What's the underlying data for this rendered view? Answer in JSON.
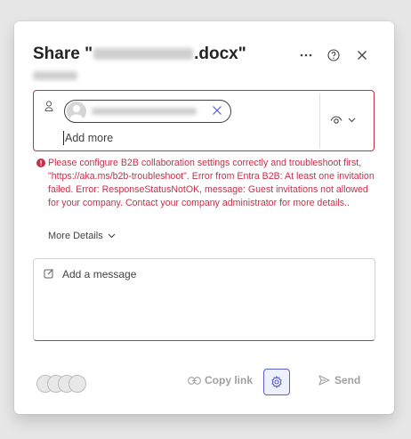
{
  "dialog": {
    "title_prefix": "Share \"",
    "title_suffix": ".docx\"",
    "more_options_icon": "ellipsis-icon",
    "help_icon": "question-circle-icon",
    "close_icon": "close-icon"
  },
  "recipients": {
    "add_more_placeholder": "Add more",
    "permission_icon": "eye-icon"
  },
  "error": {
    "message": "Please configure B2B collaboration settings correctly and troubleshoot first, \"https://aka.ms/b2b-troubleshoot\". Error from Entra B2B: At least one invitation failed. Error: ResponseStatusNotOK, message: Guest invitations not allowed for your company. Contact your company administrator for more details..",
    "more_details_label": "More Details",
    "color": "#c4314b"
  },
  "message": {
    "placeholder": "Add a message"
  },
  "footer": {
    "copy_link_label": "Copy link",
    "send_label": "Send",
    "accent": "#5b5fc7"
  }
}
